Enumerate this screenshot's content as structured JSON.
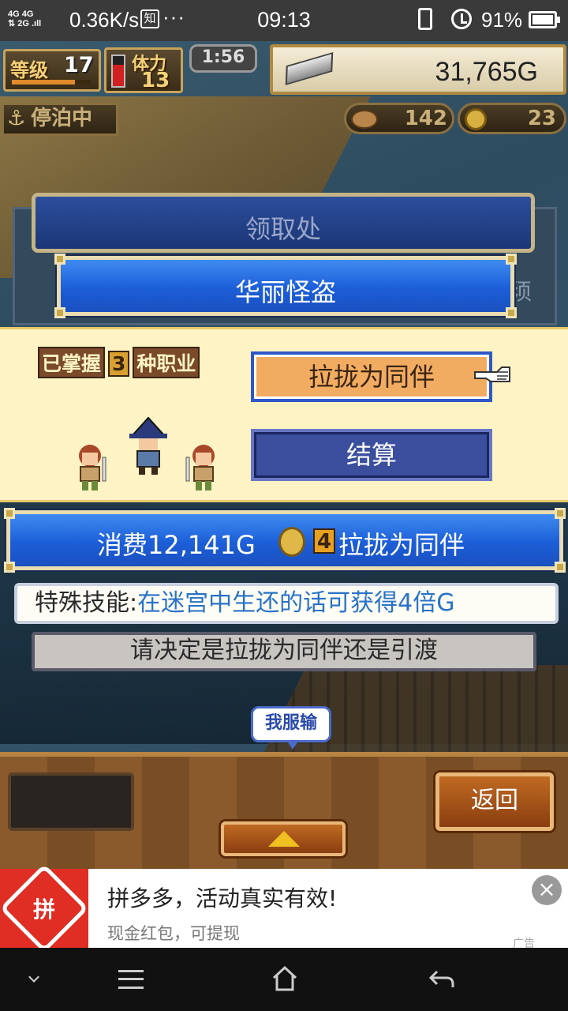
{
  "status_bar": {
    "signal_text": "4G 4G\n2G",
    "net_speed": "0.36K/s",
    "app_icon_char": "知",
    "more_dots": "···",
    "time": "09:13",
    "battery_pct": "91%"
  },
  "hud": {
    "level_label": "等级",
    "level_value": "17",
    "level_progress": 0.8,
    "stamina_label": "体力",
    "stamina_value": "13",
    "stamina_fill": 0.7,
    "timer": "1:56",
    "gold": "31,765G",
    "anchor_status": "停泊中",
    "rope_count": "142",
    "coin_count": "23"
  },
  "dialog": {
    "back_title": "领取处",
    "back_side_text": "须",
    "front_title": "华丽怪盗"
  },
  "recruit": {
    "mastered_prefix": "已掌握",
    "mastered_count": "3",
    "mastered_suffix": "种职业",
    "recruit_button": "拉拢为同伴",
    "settle_button": "结算"
  },
  "cost": {
    "text": "消费12,141G",
    "coin_count": "4",
    "label": "拉拢为同伴"
  },
  "info": {
    "skill_label": "特殊技能:",
    "skill_text": "在迷宫中生还的话可获得4倍G",
    "decide_text": "请决定是拉拢为同伴还是引渡"
  },
  "speech_bubble": "我服输",
  "bottom": {
    "back_button": "返回"
  },
  "ad": {
    "logo_text": "拼",
    "title": "拼多多，活动真实有效!",
    "subtitle": "现金红包，可提现",
    "close": "×",
    "tag": "广告"
  },
  "colors": {
    "panel_blue": "#1c5ed8",
    "recruit_bg": "#fdf3c4",
    "recruit_btn": "#f2ac62",
    "settle_btn": "#3b4f9e",
    "skill_highlight": "#2872c8",
    "ad_red": "#e02e24"
  }
}
